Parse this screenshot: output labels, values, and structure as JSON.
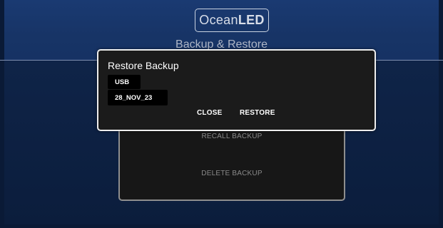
{
  "header": {
    "logo": {
      "part1": "Ocean",
      "part2": "LED"
    },
    "page_title": "Backup & Restore"
  },
  "background_panel": {
    "recall_label": "RECALL BACKUP",
    "delete_label": "DELETE BACKUP"
  },
  "modal": {
    "title": "Restore Backup",
    "source": "USB",
    "selected_backup": "28_NOV_23",
    "close_label": "CLOSE",
    "restore_label": "RESTORE"
  },
  "colors": {
    "header_bg": "#1a3a72",
    "main_bg": "#0b1d3c",
    "modal_bg": "#1b1b1b",
    "modal_border": "#eeeeee"
  }
}
